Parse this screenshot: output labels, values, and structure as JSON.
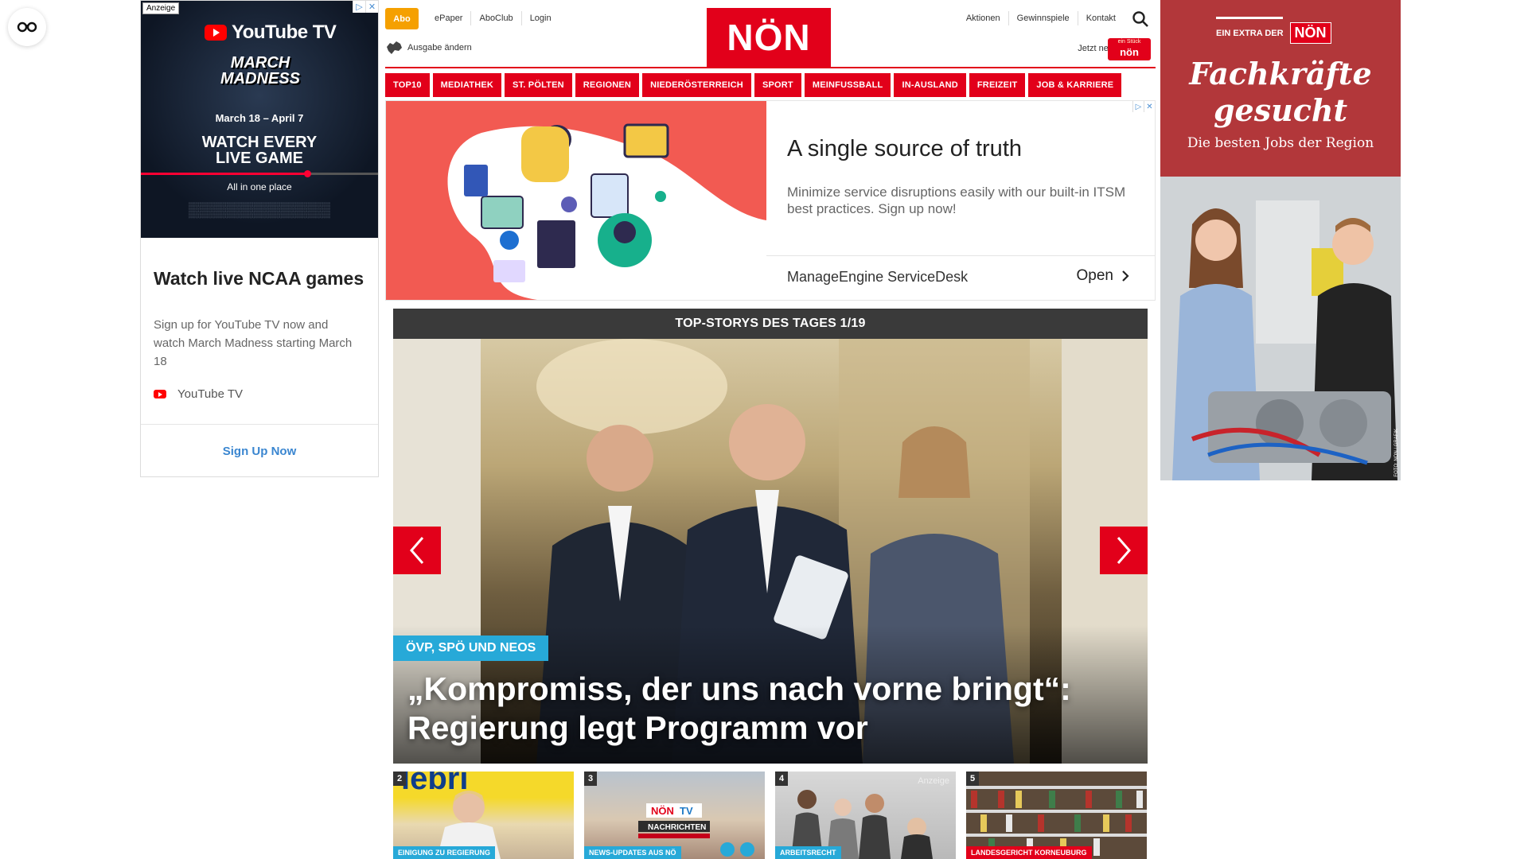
{
  "reader_button": {
    "icon": "glasses-icon"
  },
  "left_ad": {
    "label": "Anzeige",
    "close_icons": [
      "info-icon",
      "close-icon"
    ],
    "brand_logo_text": "YouTube TV",
    "event_title": "MARCH MADNESS",
    "dates": "March 18 – April 7",
    "watch_line1": "WATCH EVERY",
    "watch_line2": "LIVE GAME",
    "tagline": "All in one place",
    "progress": 0.7,
    "headline": "Watch live NCAA games",
    "description": "Sign up for YouTube TV now and watch March Madness starting March 18",
    "advertiser": "YouTube TV",
    "cta": "Sign Up Now",
    "accent_color": "#ff0000"
  },
  "header": {
    "abo": "Abo",
    "top_links": [
      "ePaper",
      "AboClub",
      "Login"
    ],
    "edition": "Ausgabe ändern",
    "logo": "NÖN",
    "right_links": [
      "Aktionen",
      "Gewinnspiele",
      "Kontakt"
    ],
    "jetzt_neu": "Jetzt neu:",
    "jetzt_logo_small": "ein Stück",
    "jetzt_logo": "nön",
    "brand_color": "#e2001a",
    "abo_color": "#f5a000"
  },
  "nav": [
    "TOP10",
    "MEDIATHEK",
    "ST. PÖLTEN",
    "REGIONEN",
    "NIEDERÖSTERREICH",
    "SPORT",
    "MEINFUSSBALL",
    "IN-AUSLAND",
    "FREIZEIT",
    "JOB & KARRIERE"
  ],
  "center_ad": {
    "title": "A single source of truth",
    "text": "Minimize service disruptions easily with our built-in ITSM best practices. Sign up now!",
    "brand": "ManageEngine ServiceDesk",
    "cta": "Open",
    "art_color": "#f25a52"
  },
  "top_stories": {
    "header": "TOP-STORYS DES TAGES 1/19",
    "tag": "ÖVP, SPÖ UND NEOS",
    "title": "„Kompromiss, der uns nach vorne bringt“: Regierung legt Programm vor",
    "tag_color": "#27a9d8"
  },
  "thumbs": [
    {
      "num": "2",
      "category": "EINIGUNG ZU REGIERUNG",
      "anzeige": ""
    },
    {
      "num": "3",
      "category": "NEWS-UPDATES AUS NÖ",
      "anzeige": ""
    },
    {
      "num": "4",
      "category": "ARBEITSRECHT",
      "anzeige": "Anzeige"
    },
    {
      "num": "5",
      "category": "LANDESGERICHT KORNEUBURG",
      "anzeige": ""
    }
  ],
  "right_ad": {
    "extra_text": "EIN EXTRA DER",
    "extra_logo": "NÖN",
    "headline_line1": "Fachkräfte",
    "headline_line2": "gesucht",
    "subline": "Die besten Jobs der Region",
    "credit": "FOTO: NÖN / GRAFIK"
  }
}
